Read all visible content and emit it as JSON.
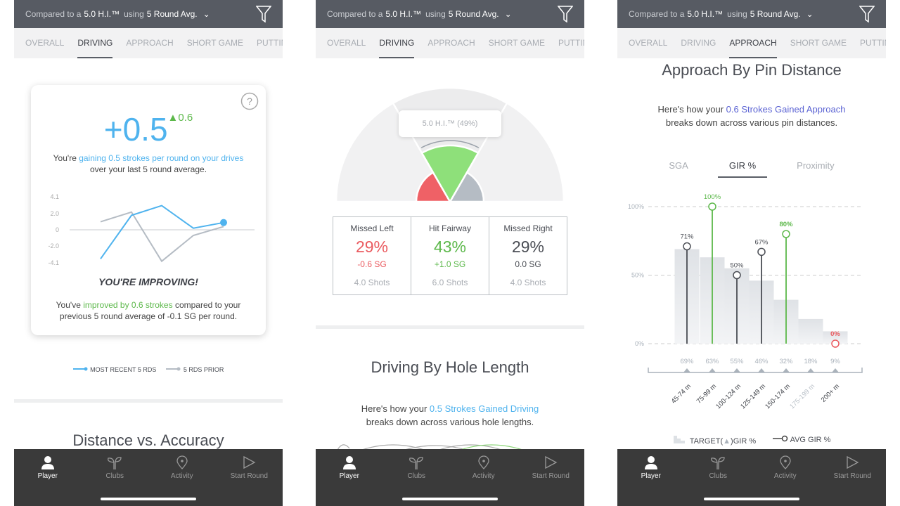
{
  "header": {
    "compared_prefix": "Compared to a",
    "hi": "5.0 H.I.™",
    "using": "using",
    "avg": "5 Round Avg."
  },
  "tabs": [
    "OVERALL",
    "DRIVING",
    "APPROACH",
    "SHORT GAME",
    "PUTTING"
  ],
  "nav": [
    {
      "label": "Player",
      "icon": "person-icon"
    },
    {
      "label": "Clubs",
      "icon": "clubs-icon"
    },
    {
      "label": "Activity",
      "icon": "location-pin-icon"
    },
    {
      "label": "Start Round",
      "icon": "play-icon"
    }
  ],
  "colors": {
    "header": "#575b63",
    "blue": "#4fb3ee",
    "green": "#5cb84a",
    "red": "#ea5a5f",
    "grey": "#b5bcc4",
    "nav": "#3a3a3a"
  },
  "panel1": {
    "active_tab": "DRIVING",
    "big_value": "+0.5",
    "delta": "0.6",
    "line1_pre": "You're ",
    "line1_hl": "gaining 0.5 strokes per round on your drives",
    "line2": "over your last 5 round average.",
    "improving": "YOU'RE IMPROVING!",
    "text2_pre": "You've ",
    "text2_hl": "improved by 0.6 strokes",
    "text2_post": " compared to your",
    "text2_line2": "previous 5 round average of -0.1 SG per round.",
    "legend": [
      "MOST RECENT 5 RDS",
      "5 RDS PRIOR"
    ],
    "next_title": "Distance vs. Accuracy"
  },
  "panel2": {
    "active_tab": "DRIVING",
    "tooltip": "5.0 H.I.™ (49%)",
    "stats": [
      {
        "label": "Missed Left",
        "pct": "29%",
        "sg": "-0.6 SG",
        "shots": "4.0 Shots",
        "color": "#ea5a5f"
      },
      {
        "label": "Hit Fairway",
        "pct": "43%",
        "sg": "+1.0 SG",
        "shots": "6.0 Shots",
        "color": "#5cb84a"
      },
      {
        "label": "Missed Right",
        "pct": "29%",
        "sg": "0.0 SG",
        "shots": "4.0 Shots",
        "color": "#4a4d54"
      }
    ],
    "title": "Driving By Hole Length",
    "desc_pre": "Here's how your ",
    "desc_hl": "0.5 Strokes Gained Driving",
    "desc_line2": "breaks down across various hole lengths."
  },
  "panel3": {
    "active_tab": "APPROACH",
    "title": "Approach By Pin Distance",
    "desc_pre": "Here's how your ",
    "desc_hl": "0.6 Strokes Gained Approach",
    "desc_line2": "breaks down across various pin distances.",
    "subtabs": [
      "SGA",
      "GIR %",
      "Proximity"
    ],
    "active_subtab": "GIR %",
    "legend": [
      "TARGET(",
      ")GIR %",
      "AVG GIR %"
    ]
  },
  "chart_data": [
    {
      "type": "line",
      "yticks": [
        "4.1",
        "2.0",
        "0",
        "-2.0",
        "-4.1"
      ],
      "ylim": [
        -4.1,
        4.1
      ],
      "series": [
        {
          "name": "MOST RECENT 5 RDS",
          "values": [
            -3.6,
            1.8,
            3.0,
            0.2,
            0.9
          ]
        },
        {
          "name": "5 RDS PRIOR",
          "values": [
            1.0,
            2.2,
            -3.9,
            -0.7,
            0.4
          ]
        }
      ]
    },
    {
      "type": "pie",
      "slices": [
        {
          "label": "Missed Left",
          "value": 29
        },
        {
          "label": "Hit Fairway",
          "value": 43
        },
        {
          "label": "Missed Right",
          "value": 29
        }
      ]
    },
    {
      "type": "bar",
      "categories": [
        "45-74 m",
        "75-99 m",
        "100-124 m",
        "125-149 m",
        "150-174 m",
        "175-199 m",
        "200+ m"
      ],
      "yticks": [
        "100%",
        "50%",
        "0%"
      ],
      "ylim": [
        0,
        100
      ],
      "target": [
        69,
        63,
        55,
        46,
        32,
        18,
        9
      ],
      "target_labels": [
        "69%",
        "63%",
        "55%",
        "46%",
        "32%",
        "18%",
        "9%"
      ],
      "avg": [
        71,
        100,
        50,
        67,
        80,
        null,
        0
      ],
      "avg_labels": [
        "71%",
        "100%",
        "50%",
        "67%",
        "80%",
        "",
        "0%"
      ]
    }
  ]
}
